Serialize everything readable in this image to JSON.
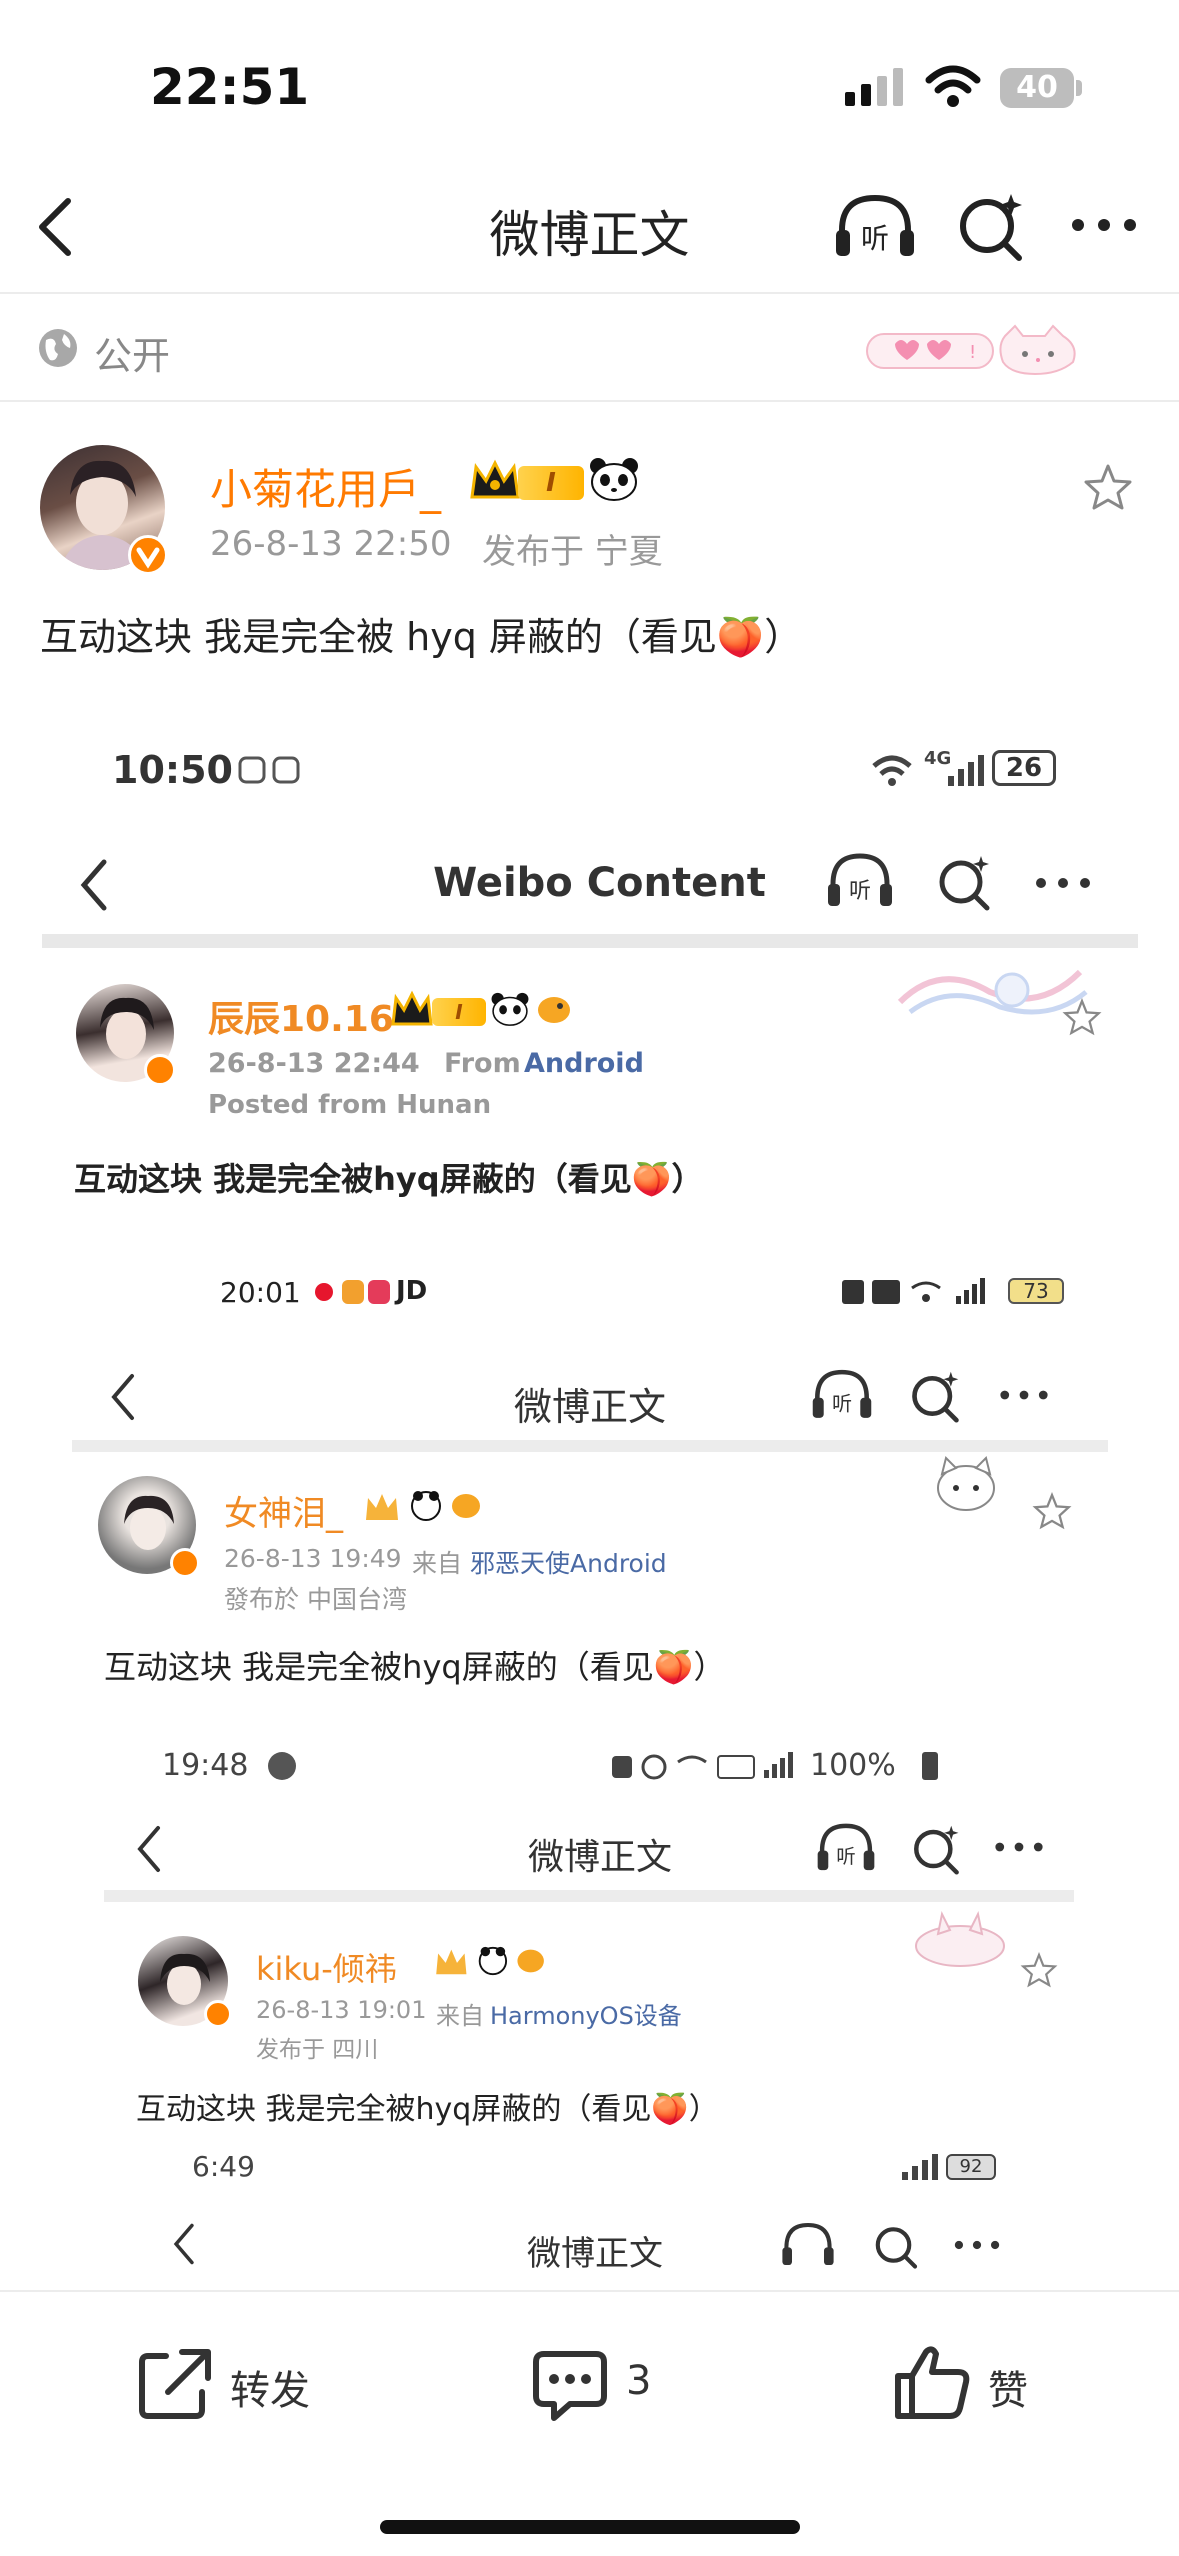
{
  "status_bar": {
    "time": "22:51",
    "battery": "40"
  },
  "nav": {
    "title": "微博正文"
  },
  "subheader": {
    "visibility": "公开"
  },
  "post": {
    "username": "小菊花用戶_",
    "vip_level": "I",
    "timestamp": "26-8-13 22:50",
    "location": "发布于 宁夏",
    "content": "互动这块 我是完全被 hyq 屏蔽的（看见🍑）"
  },
  "nested1": {
    "status_time": "10:50",
    "signal": "4G",
    "battery": "26",
    "nav_title": "Weibo Content",
    "username": "辰辰10.16",
    "vip_level": "I",
    "timestamp": "26-8-13 22:44",
    "from_label": "From",
    "from_device": "Android",
    "location": "Posted from Hunan",
    "content": "互动这块 我是完全被hyq屏蔽的（看见🍑）"
  },
  "nested2": {
    "status_time": "20:01",
    "status_extra": "JD",
    "battery": "73",
    "nav_title": "微博正文",
    "username": "女神泪_",
    "timestamp": "26-8-13 19:49",
    "from_label": "来自",
    "from_device": "邪恶天使Android",
    "location": "發布於 中国台湾",
    "content": "互动这块 我是完全被hyq屏蔽的（看见🍑）"
  },
  "nested3": {
    "status_time": "19:48",
    "battery": "100%",
    "nav_title": "微博正文",
    "username": "kiku-倾祎",
    "timestamp": "26-8-13 19:01",
    "from_label": "来自",
    "from_device": "HarmonyOS设备",
    "location": "发布于 四川",
    "content": "互动这块 我是完全被hyq屏蔽的（看见🍑）"
  },
  "nested4": {
    "status_time": "6:49",
    "battery": "92",
    "nav_title": "微博正文"
  },
  "bottom_bar": {
    "repost_label": "转发",
    "comment_count": "3",
    "like_label": "赞"
  },
  "colors": {
    "accent": "#ff7a00",
    "link": "#4a6aa5",
    "text": "#222222",
    "muted": "#999999"
  },
  "icons": [
    "back-icon",
    "listen-icon",
    "search-icon",
    "more-icon",
    "globe-icon",
    "star-icon",
    "repost-icon",
    "comment-icon",
    "like-icon"
  ]
}
